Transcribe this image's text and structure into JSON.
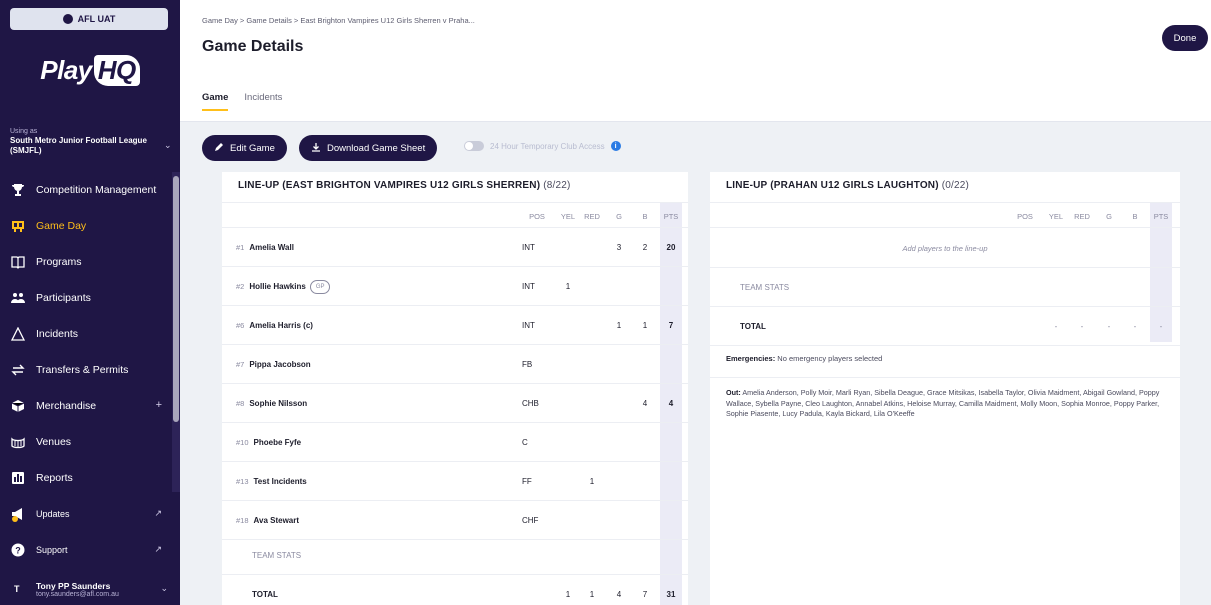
{
  "sidebar": {
    "env_label": "AFL UAT",
    "logo_play": "Play",
    "logo_hq": "HQ",
    "using_as": "Using as",
    "org": "South Metro Junior Football League (SMJFL)",
    "items": [
      {
        "label": "Competition Management",
        "icon": "trophy-icon"
      },
      {
        "label": "Game Day",
        "icon": "scoreboard-icon"
      },
      {
        "label": "Programs",
        "icon": "book-icon"
      },
      {
        "label": "Participants",
        "icon": "people-icon"
      },
      {
        "label": "Incidents",
        "icon": "warning-icon"
      },
      {
        "label": "Transfers & Permits",
        "icon": "transfer-icon"
      },
      {
        "label": "Merchandise",
        "icon": "box-icon"
      },
      {
        "label": "Venues",
        "icon": "stadium-icon"
      },
      {
        "label": "Reports",
        "icon": "report-icon"
      },
      {
        "label": "Updates",
        "icon": "megaphone-icon"
      },
      {
        "label": "Support",
        "icon": "help-icon"
      }
    ],
    "user": {
      "initial": "T",
      "name": "Tony PP Saunders",
      "email": "tony.saunders@afl.com.au"
    }
  },
  "header": {
    "breadcrumb": "Game Day  >  Game Details  >  East Brighton Vampires U12 Girls Sherren v Praha...",
    "title": "Game Details",
    "done_label": "Done",
    "tabs": [
      "Game",
      "Incidents"
    ]
  },
  "toolbar": {
    "edit_label": "Edit Game",
    "download_label": "Download Game Sheet",
    "toggle_label": "24 Hour Temporary Club Access"
  },
  "columns": [
    "POS",
    "YEL",
    "RED",
    "G",
    "B",
    "PTS"
  ],
  "left_panel": {
    "title": "LINE-UP (EAST BRIGHTON VAMPIRES U12 GIRLS SHERREN)",
    "count": "(8/22)",
    "players": [
      {
        "num": "#1",
        "name": "Amelia Wall",
        "pos": "INT",
        "yel": "",
        "red": "",
        "g": "3",
        "b": "2",
        "pts": "20",
        "badge": ""
      },
      {
        "num": "#2",
        "name": "Hollie Hawkins",
        "pos": "INT",
        "yel": "1",
        "red": "",
        "g": "",
        "b": "",
        "pts": "",
        "badge": "GP"
      },
      {
        "num": "#6",
        "name": "Amelia Harris (c)",
        "pos": "INT",
        "yel": "",
        "red": "",
        "g": "1",
        "b": "1",
        "pts": "7",
        "badge": ""
      },
      {
        "num": "#7",
        "name": "Pippa Jacobson",
        "pos": "FB",
        "yel": "",
        "red": "",
        "g": "",
        "b": "",
        "pts": "",
        "badge": ""
      },
      {
        "num": "#8",
        "name": "Sophie Nilsson",
        "pos": "CHB",
        "yel": "",
        "red": "",
        "g": "",
        "b": "4",
        "pts": "4",
        "badge": ""
      },
      {
        "num": "#10",
        "name": "Phoebe Fyfe",
        "pos": "C",
        "yel": "",
        "red": "",
        "g": "",
        "b": "",
        "pts": "",
        "badge": ""
      },
      {
        "num": "#13",
        "name": "Test Incidents",
        "pos": "FF",
        "yel": "",
        "red": "1",
        "g": "",
        "b": "",
        "pts": "",
        "badge": ""
      },
      {
        "num": "#18",
        "name": "Ava Stewart",
        "pos": "CHF",
        "yel": "",
        "red": "",
        "g": "",
        "b": "",
        "pts": "",
        "badge": ""
      }
    ],
    "team_stats": "TEAM STATS",
    "total_label": "TOTAL",
    "totals": {
      "yel": "1",
      "red": "1",
      "g": "4",
      "b": "7",
      "pts": "31"
    }
  },
  "right_panel": {
    "title": "LINE-UP (PRAHAN U12 GIRLS LAUGHTON)",
    "count": "(0/22)",
    "add_players": "Add players to the line-up",
    "team_stats": "TEAM STATS",
    "total_label": "TOTAL",
    "totals": {
      "yel": "-",
      "red": "-",
      "g": "-",
      "b": "-",
      "pts": "-"
    },
    "emergencies_label": "Emergencies:",
    "emergencies_text": "No emergency players selected",
    "out_label": "Out:",
    "out_text": "Amelia Anderson, Polly Moir, Marli Ryan, Sibella Deague, Grace Mitsikas, Isabella Taylor, Olivia Maidment, Abigail Gowland, Poppy Wallace, Sybella Payne, Cleo Laughton, Annabel Atkins, Heloise Murray, Camilla Maidment, Molly Moon, Sophia Monroe, Poppy Parker, Sophie Piasente, Lucy Padula, Kayla Bickard, Lila O'Keeffe"
  }
}
